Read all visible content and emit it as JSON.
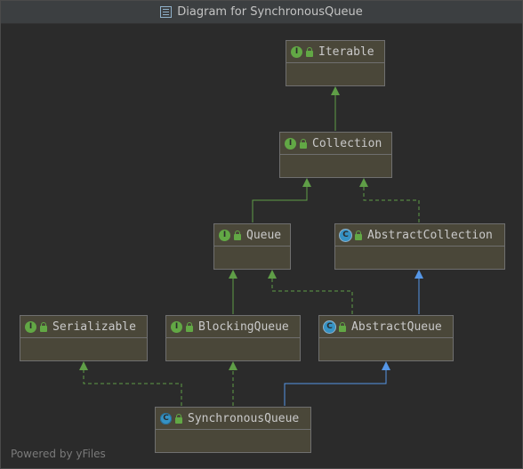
{
  "window": {
    "title": "Diagram for SynchronousQueue"
  },
  "nodes": {
    "iterable": {
      "name": "Iterable",
      "kind": "I"
    },
    "collection": {
      "name": "Collection",
      "kind": "I"
    },
    "queue": {
      "name": "Queue",
      "kind": "I"
    },
    "abstract_collection": {
      "name": "AbstractCollection",
      "kind": "C"
    },
    "serializable": {
      "name": "Serializable",
      "kind": "I"
    },
    "blocking_queue": {
      "name": "BlockingQueue",
      "kind": "I"
    },
    "abstract_queue": {
      "name": "AbstractQueue",
      "kind": "C"
    },
    "synchronous_queue": {
      "name": "SynchronousQueue",
      "kind": "C"
    }
  },
  "footer": {
    "text": "Powered by yFiles"
  },
  "colors": {
    "extends_interface": "#5f9e47",
    "implements": "#5f9e47",
    "extends_class": "#5596e6",
    "node_fill": "#4a4739",
    "background": "#2b2b2b"
  }
}
